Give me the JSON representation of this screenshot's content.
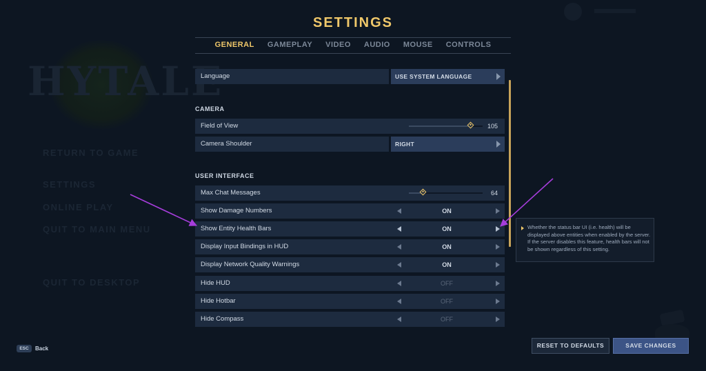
{
  "background_menu": {
    "logo_text": "HYTALE",
    "items": [
      "RETURN TO GAME",
      "SETTINGS",
      "ONLINE PLAY",
      "QUIT TO MAIN MENU",
      "QUIT TO DESKTOP"
    ]
  },
  "title": "SETTINGS",
  "tabs": [
    {
      "label": "GENERAL",
      "active": true
    },
    {
      "label": "GAMEPLAY",
      "active": false
    },
    {
      "label": "VIDEO",
      "active": false
    },
    {
      "label": "AUDIO",
      "active": false
    },
    {
      "label": "MOUSE",
      "active": false
    },
    {
      "label": "CONTROLS",
      "active": false
    }
  ],
  "general": {
    "language": {
      "label": "Language",
      "value": "USE SYSTEM LANGUAGE"
    }
  },
  "camera": {
    "heading": "CAMERA",
    "field_of_view": {
      "label": "Field of View",
      "value": "105",
      "fraction": 0.84
    },
    "camera_shoulder": {
      "label": "Camera Shoulder",
      "value": "RIGHT"
    }
  },
  "user_interface": {
    "heading": "USER INTERFACE",
    "max_chat_messages": {
      "label": "Max Chat Messages",
      "value": "64",
      "fraction": 0.2
    },
    "toggles": [
      {
        "label": "Show Damage Numbers",
        "value": "ON",
        "on": true
      },
      {
        "label": "Show Entity Health Bars",
        "value": "ON",
        "on": true
      },
      {
        "label": "Display Input Bindings in HUD",
        "value": "ON",
        "on": true
      },
      {
        "label": "Display Network Quality Warnings",
        "value": "ON",
        "on": true
      },
      {
        "label": "Hide HUD",
        "value": "OFF",
        "on": false
      },
      {
        "label": "Hide Hotbar",
        "value": "OFF",
        "on": false
      },
      {
        "label": "Hide Compass",
        "value": "OFF",
        "on": false
      }
    ]
  },
  "tooltip": {
    "text": "Whether the status bar UI (i.e. health) will be displayed above entities when enabled by the server. If the server disables this feature, health bars will not be shown regardless of this setting."
  },
  "footer": {
    "esc_key": "ESC",
    "back_label": "Back",
    "reset_label": "RESET TO DEFAULTS",
    "save_label": "SAVE CHANGES"
  },
  "colors": {
    "accent": "#f0c86a",
    "annotation_arrow": "#a63ddb",
    "save_button": "#3c5486"
  }
}
